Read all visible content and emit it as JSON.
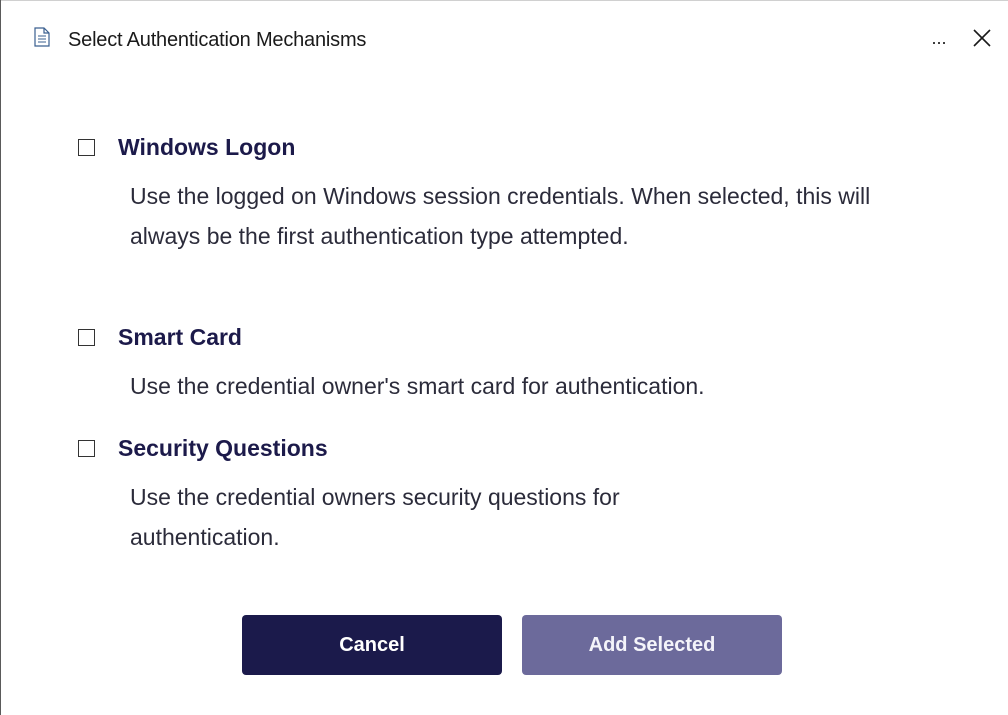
{
  "window": {
    "title": "Select Authentication Mechanisms",
    "more_label": "...",
    "icons": {
      "title_icon": "document-icon",
      "close_icon": "close-icon"
    }
  },
  "options": [
    {
      "label": "Windows Logon",
      "description": "Use the logged on Windows session credentials. When selected, this will always be the first authentication type attempted.",
      "checked": false
    },
    {
      "label": "Smart Card",
      "description": "Use the credential owner's smart card for authentication.",
      "checked": false
    },
    {
      "label": "Security Questions",
      "description": "Use the credential owners security questions for authentication.",
      "checked": false
    }
  ],
  "buttons": {
    "cancel_label": "Cancel",
    "add_label": "Add Selected"
  },
  "colors": {
    "primary": "#1b1a4b",
    "primary_disabled": "#6c6a9b",
    "label_text": "#1c1a4a"
  }
}
